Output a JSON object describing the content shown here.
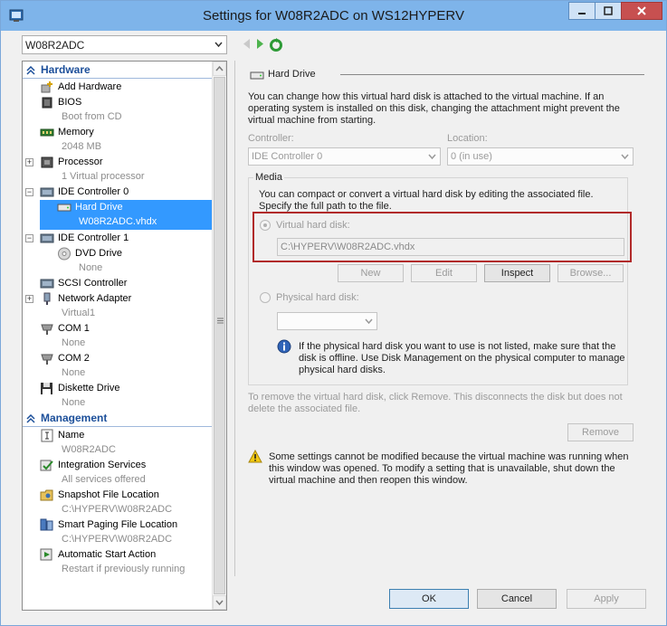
{
  "window": {
    "title": "Settings for W08R2ADC on WS12HYPERV",
    "vm_name": "W08R2ADC"
  },
  "tree": {
    "hardware_header": "Hardware",
    "management_header": "Management",
    "items": [
      {
        "label": "Add Hardware",
        "sub": ""
      },
      {
        "label": "BIOS",
        "sub": "Boot from CD"
      },
      {
        "label": "Memory",
        "sub": "2048 MB"
      },
      {
        "label": "Processor",
        "sub": "1 Virtual processor"
      },
      {
        "label": "IDE Controller 0",
        "sub": ""
      },
      {
        "label": "Hard Drive",
        "sub": "W08R2ADC.vhdx"
      },
      {
        "label": "IDE Controller 1",
        "sub": ""
      },
      {
        "label": "DVD Drive",
        "sub": "None"
      },
      {
        "label": "SCSI Controller",
        "sub": ""
      },
      {
        "label": "Network Adapter",
        "sub": "Virtual1"
      },
      {
        "label": "COM 1",
        "sub": "None"
      },
      {
        "label": "COM 2",
        "sub": "None"
      },
      {
        "label": "Diskette Drive",
        "sub": "None"
      },
      {
        "label": "Name",
        "sub": "W08R2ADC"
      },
      {
        "label": "Integration Services",
        "sub": "All services offered"
      },
      {
        "label": "Snapshot File Location",
        "sub": "C:\\HYPERV\\W08R2ADC"
      },
      {
        "label": "Smart Paging File Location",
        "sub": "C:\\HYPERV\\W08R2ADC"
      },
      {
        "label": "Automatic Start Action",
        "sub": "Restart if previously running"
      }
    ]
  },
  "details": {
    "group_title": "Hard Drive",
    "intro": [
      "You can change how this virtual hard disk is attached to the virtual machine. If an",
      "operating system is installed on this disk, changing the attachment might prevent the",
      "virtual machine from starting."
    ],
    "controller_label": "Controller:",
    "controller_value": "IDE Controller 0",
    "location_label": "Location:",
    "location_value": "0 (in use)",
    "media_label": "Media",
    "media_text": [
      "You can compact or convert a virtual hard disk by editing the associated file.",
      "Specify the full path to the file."
    ],
    "virtual_disk_label": "Virtual hard disk:",
    "virtual_disk_path": "C:\\HYPERV\\W08R2ADC.vhdx",
    "buttons": {
      "new": "New",
      "edit": "Edit",
      "inspect": "Inspect",
      "browse": "Browse..."
    },
    "physical_disk_label": "Physical hard disk:",
    "physical_info": [
      "If the physical hard disk you want to use is not listed, make sure that the",
      "disk is offline. Use Disk Management on the physical computer to manage",
      "physical hard disks."
    ],
    "remove_text": [
      "To remove the virtual hard disk, click Remove. This disconnects the disk but does not",
      "delete the associated file."
    ],
    "remove_button": "Remove",
    "warning_text": [
      "Some settings cannot be modified because the virtual machine was running when",
      "this window was opened. To modify a setting that is unavailable, shut down the",
      "virtual machine and then reopen this window."
    ]
  },
  "footer": {
    "ok": "OK",
    "cancel": "Cancel",
    "apply": "Apply"
  },
  "colors": {
    "accent": "#3399ff",
    "titlebar": "#7eb4ea",
    "highlight_border": "#b12a2a",
    "section_header": "#1c4f9a"
  }
}
